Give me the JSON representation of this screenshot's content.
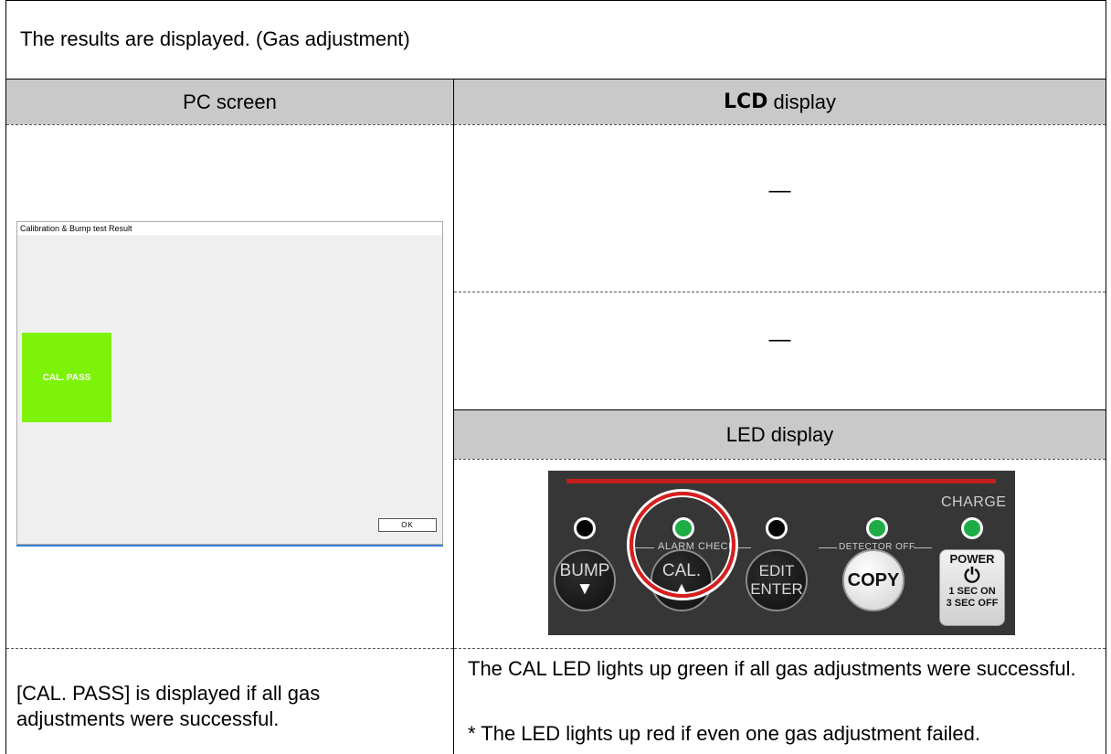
{
  "header": {
    "title": "The results are displayed. (Gas adjustment)"
  },
  "columns": {
    "pc_screen": "PC screen",
    "lcd_bold": "LCD",
    "lcd_rest": " display",
    "led_display": "LED display"
  },
  "lcd_cells": [
    "—",
    "—"
  ],
  "pc_window": {
    "title": "Calibration & Bump test Result",
    "result_label": "CAL. PASS",
    "result_color": "#7ef30a",
    "ok_button": "OK"
  },
  "led_panel": {
    "charge_label": "CHARGE",
    "alarm_check_label": "ALARM CHECK",
    "detector_off_label": "DETECTOR OFF",
    "buttons": {
      "bump": "BUMP",
      "cal": "CAL.",
      "edit": "EDIT",
      "enter": "ENTER",
      "copy": "COPY",
      "power": "POWER",
      "sec_on": "1 SEC ON",
      "sec_off": "3 SEC OFF"
    },
    "leds": [
      {
        "name": "bump",
        "state": "off"
      },
      {
        "name": "cal",
        "state": "green"
      },
      {
        "name": "edit",
        "state": "off"
      },
      {
        "name": "copy",
        "state": "green"
      },
      {
        "name": "charge",
        "state": "green"
      }
    ],
    "highlight_color": "#d81e1e"
  },
  "footer": {
    "pc_note": "[CAL. PASS] is displayed if all gas adjustments were successful.",
    "led_note": "The CAL LED lights up green if all gas adjustments were successful.",
    "led_note_2": "* The LED lights up red if even one gas adjustment failed."
  }
}
